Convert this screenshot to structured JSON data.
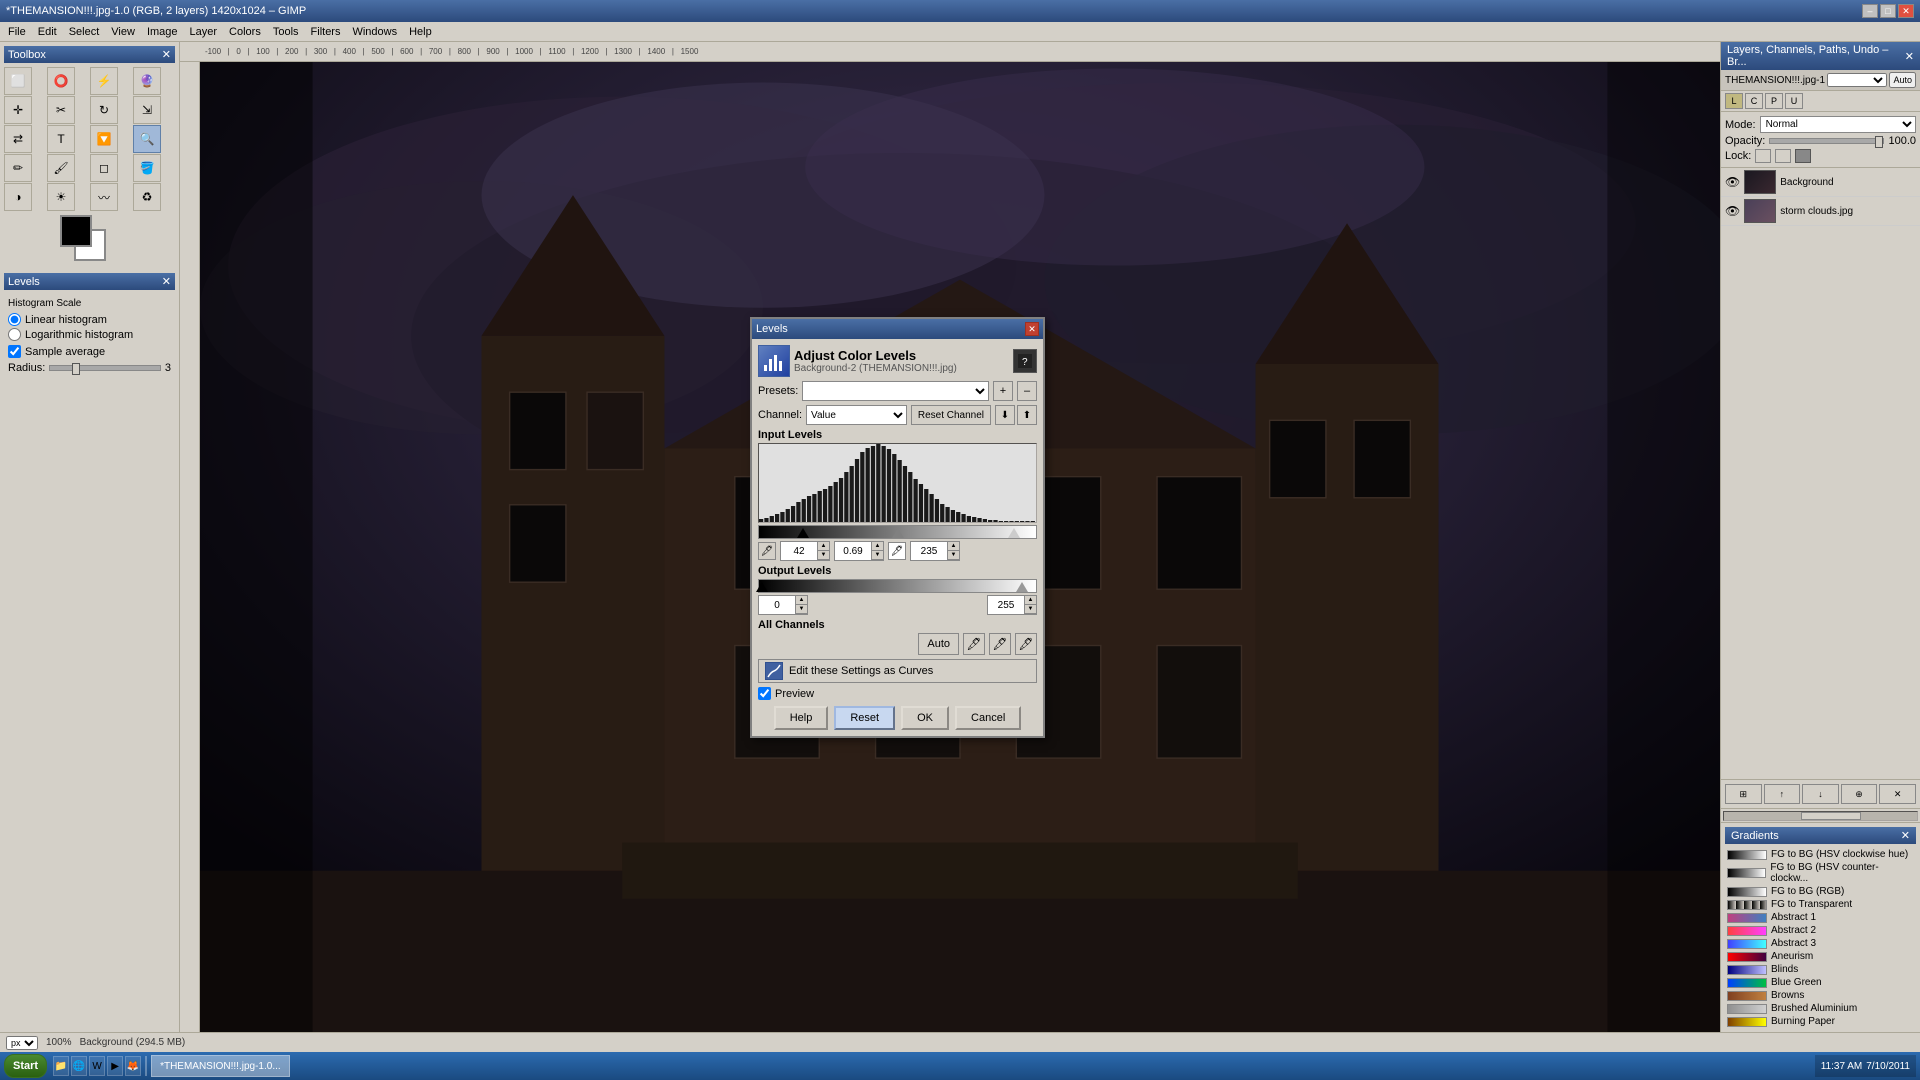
{
  "window": {
    "title": "*THEMANSION!!!.jpg-1.0 (RGB, 2 layers) 1420x1024 – GIMP",
    "close_btn": "✕",
    "min_btn": "–",
    "max_btn": "□"
  },
  "menu": {
    "items": [
      "File",
      "Edit",
      "Select",
      "View",
      "Image",
      "Layer",
      "Colors",
      "Tools",
      "Filters",
      "Windows",
      "Help"
    ]
  },
  "toolbox": {
    "title": "Toolbox",
    "fg_color": "#000000",
    "bg_color": "#ffffff"
  },
  "levels_side_panel": {
    "title": "Levels",
    "histogram_scale": "Histogram Scale",
    "linear_label": "Linear histogram",
    "logarithmic_label": "Logarithmic histogram",
    "sample_average_label": "Sample average",
    "radius_label": "Radius:",
    "radius_value": "3"
  },
  "canvas": {
    "zoom": "100%",
    "filename": "Background (294.5 MB)"
  },
  "layers_panel": {
    "title": "Layers, Channels, Paths, Undo – Br...",
    "filename": "THEMANSION!!!.jpg-1",
    "mode_label": "Mode:",
    "mode_value": "Normal",
    "opacity_label": "Opacity:",
    "opacity_value": "100.0",
    "lock_label": "Lock:",
    "layers": [
      {
        "name": "Background",
        "visible": true,
        "type": "dark"
      },
      {
        "name": "storm clouds.jpg",
        "visible": true,
        "type": "light"
      }
    ]
  },
  "gradients_panel": {
    "title": "Gradients",
    "items": [
      {
        "name": "FG to BG (HSV clockwise hue)",
        "color1": "#000000",
        "color2": "#ffffff"
      },
      {
        "name": "FG to BG (HSV counter-clockw...",
        "color1": "#000000",
        "color2": "#ffffff"
      },
      {
        "name": "FG to BG (RGB)",
        "color1": "#000000",
        "color2": "#ffffff"
      },
      {
        "name": "FG to Transparent",
        "color1": "#000000",
        "color2": "transparent"
      },
      {
        "name": "Abstract 1",
        "color1": "#c04080",
        "color2": "#4080c0"
      },
      {
        "name": "Abstract 2",
        "color1": "#ff4040",
        "color2": "#ff40ff"
      },
      {
        "name": "Abstract 3",
        "color1": "#4040ff",
        "color2": "#40ffff"
      },
      {
        "name": "Aneurism",
        "color1": "#ff0000",
        "color2": "#400040"
      },
      {
        "name": "Blinds",
        "color1": "#000080",
        "color2": "#c0c0ff"
      },
      {
        "name": "Blue Green",
        "color1": "#0040ff",
        "color2": "#00c040"
      },
      {
        "name": "Browns",
        "color1": "#804020",
        "color2": "#c08040"
      },
      {
        "name": "Brushed Aluminium",
        "color1": "#909090",
        "color2": "#d0d0d0"
      },
      {
        "name": "Burning Paper",
        "color1": "#804000",
        "color2": "#ffff00"
      }
    ]
  },
  "levels_dialog": {
    "title": "Levels",
    "dialog_title": "Adjust Color Levels",
    "subtitle": "Background-2 (THEMANSION!!!.jpg)",
    "presets_label": "Presets:",
    "channel_label": "Channel:",
    "channel_value": "Value",
    "reset_channel_btn": "Reset Channel",
    "input_levels_label": "Input Levels",
    "output_levels_label": "Output Levels",
    "all_channels_label": "All Channels",
    "auto_btn": "Auto",
    "edit_curves_text": "Edit these Settings as Curves",
    "preview_label": "Preview",
    "help_btn": "Help",
    "reset_btn": "Reset",
    "ok_btn": "OK",
    "cancel_btn": "Cancel",
    "input_black": "42",
    "input_gray": "0.69",
    "input_white": "235",
    "output_left": "0",
    "output_right": "255",
    "close_btn": "✕"
  },
  "status_bar": {
    "unit": "px",
    "zoom": "100%",
    "info": "Background (294.5 MB)"
  },
  "taskbar": {
    "start_label": "Start",
    "time": "11:37 AM",
    "date": "7/10/2011",
    "items": [
      {
        "label": "*THEMANSION!!!.jpg-1.0...",
        "active": true
      }
    ]
  }
}
